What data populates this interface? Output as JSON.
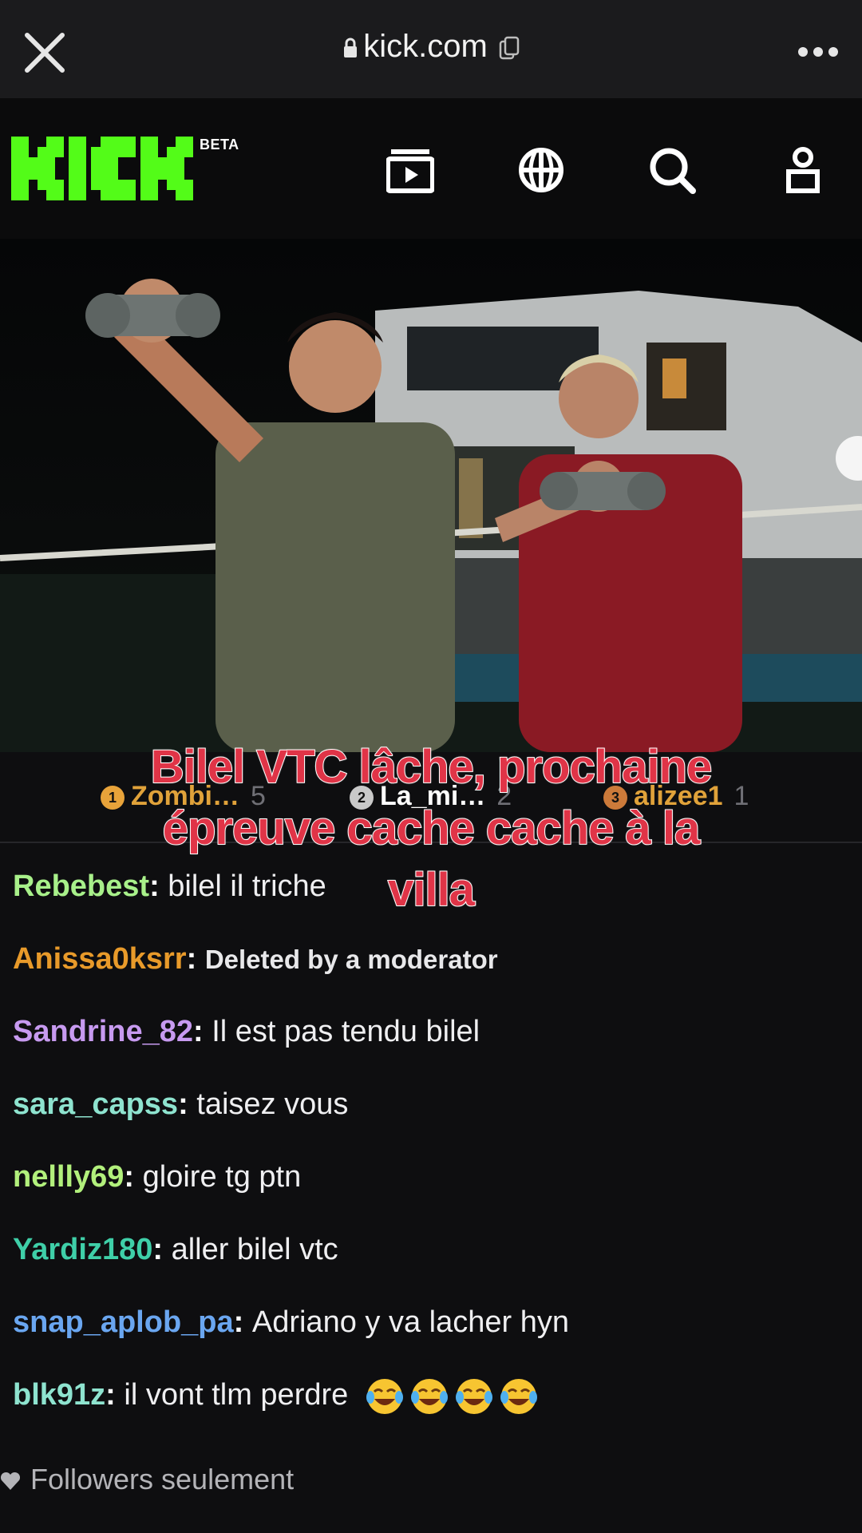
{
  "browser": {
    "url": "kick.com"
  },
  "header": {
    "beta": "BETA",
    "brand_color": "#53fc18"
  },
  "leaderboard": [
    {
      "rank": "1",
      "name": "Zombi…",
      "count": "5",
      "badge_color": "#e8a33a"
    },
    {
      "rank": "2",
      "name": "La_mi…",
      "count": "2",
      "badge_color": "#c9c9c9"
    },
    {
      "rank": "3",
      "name": "alizee1",
      "count": "1",
      "badge_color": "#cc7a3a"
    }
  ],
  "caption": {
    "line1": "Bilel VTC lâche, prochaine",
    "line2": "épreuve cache cache à la",
    "line3": "villa"
  },
  "chat": [
    {
      "user": "Rebebest",
      "color": "#a8f08a",
      "text": "bilel il triche"
    },
    {
      "user": "Anissa0ksrr",
      "color": "#e89a2a",
      "text": "Deleted by a moderator",
      "deleted": true
    },
    {
      "user": "Sandrine_82",
      "color": "#c79af0",
      "text": "Il est pas tendu bilel"
    },
    {
      "user": "sara_capss",
      "color": "#8ee3cf",
      "text": "taisez vous"
    },
    {
      "user": "nellly69",
      "color": "#b2f07c",
      "text": "gloire tg ptn"
    },
    {
      "user": "Yardiz180",
      "color": "#3fcfa8",
      "text": "aller bilel vtc"
    },
    {
      "user": "snap_aplob_pa",
      "color": "#6aa6f0",
      "text": "Adriano y va lacher hyn"
    },
    {
      "user": "blk91z",
      "color": "#8ee3cf",
      "text": "il vont tlm perdre",
      "emoji": "face-with-tears-of-joy-icon x4"
    }
  ],
  "footer": {
    "followers_only": "Followers seulement"
  }
}
